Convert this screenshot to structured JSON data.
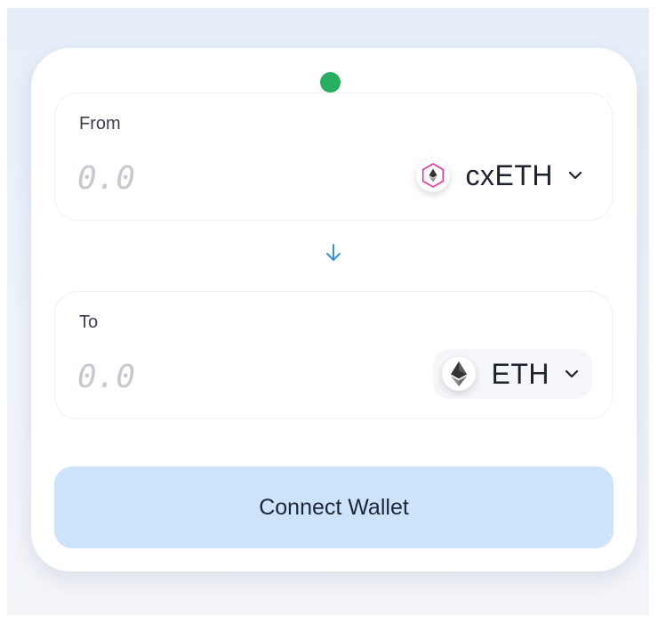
{
  "status": {
    "color": "#27ae60"
  },
  "from": {
    "label": "From",
    "amount_placeholder": "0.0",
    "token": {
      "symbol": "cxETH",
      "icon": "cxeth-hexagon-icon",
      "accent_color": "#e0399a"
    }
  },
  "swap": {
    "icon": "arrow-down-icon",
    "color": "#3b8de0"
  },
  "to": {
    "label": "To",
    "amount_placeholder": "0.0",
    "token": {
      "symbol": "ETH",
      "icon": "eth-diamond-icon"
    }
  },
  "action": {
    "label": "Connect Wallet",
    "background": "#cde3fa"
  }
}
